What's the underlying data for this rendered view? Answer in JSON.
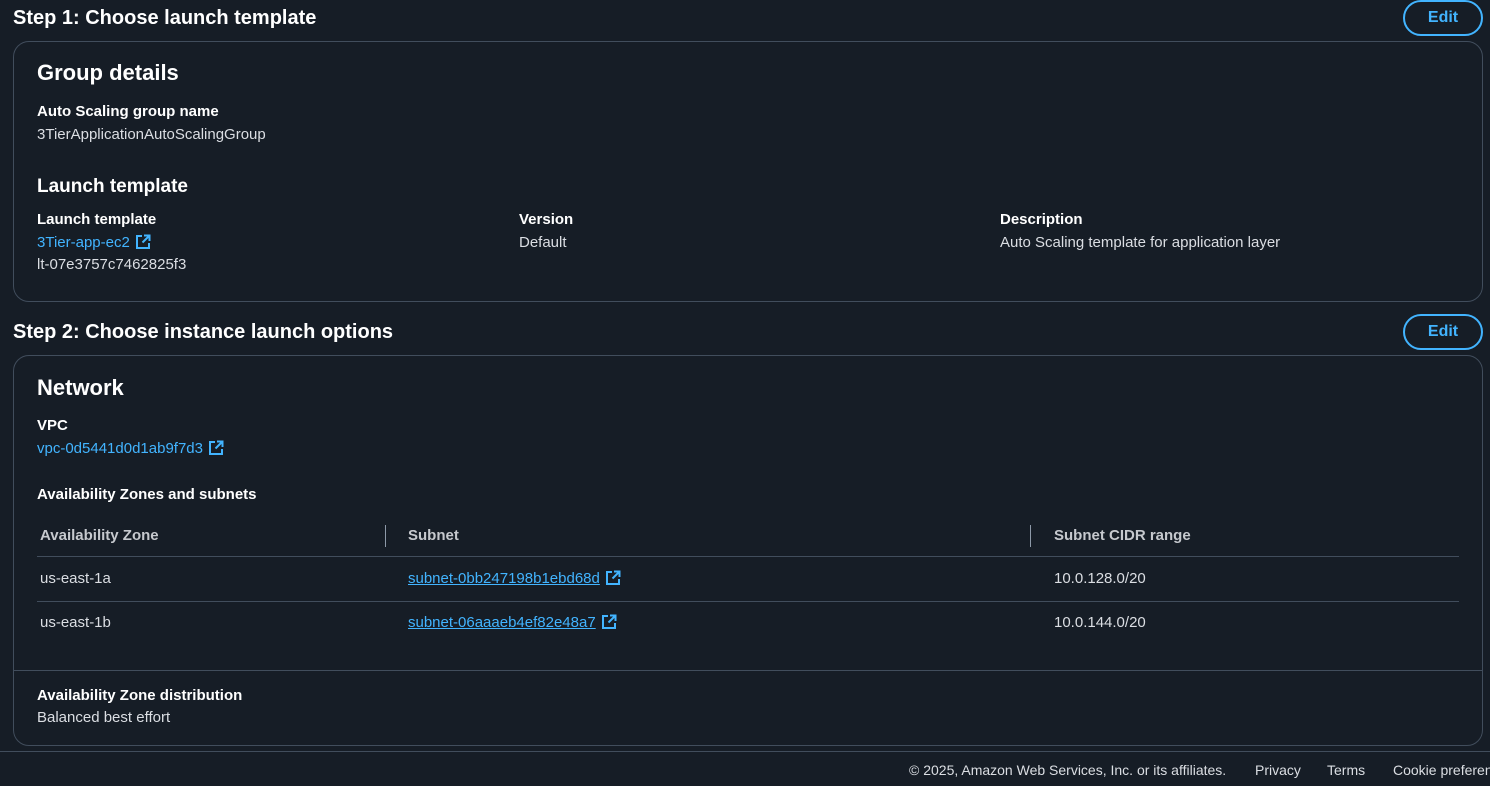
{
  "step1": {
    "title": "Step 1: Choose launch template",
    "edit_label": "Edit",
    "group_details": {
      "heading": "Group details",
      "name_label": "Auto Scaling group name",
      "name_value": "3TierApplicationAutoScalingGroup"
    },
    "launch_template": {
      "heading": "Launch template",
      "template_label": "Launch template",
      "template_link": "3Tier-app-ec2",
      "template_id": "lt-07e3757c7462825f3",
      "version_label": "Version",
      "version_value": "Default",
      "description_label": "Description",
      "description_value": "Auto Scaling template for application layer"
    }
  },
  "step2": {
    "title": "Step 2: Choose instance launch options",
    "edit_label": "Edit",
    "network": {
      "heading": "Network",
      "vpc_label": "VPC",
      "vpc_link": "vpc-0d5441d0d1ab9f7d3",
      "az_heading": "Availability Zones and subnets",
      "columns": [
        "Availability Zone",
        "Subnet",
        "Subnet CIDR range"
      ],
      "rows": [
        {
          "zone": "us-east-1a",
          "subnet": "subnet-0bb247198b1ebd68d",
          "cidr": "10.0.128.0/20"
        },
        {
          "zone": "us-east-1b",
          "subnet": "subnet-06aaaeb4ef82e48a7",
          "cidr": "10.0.144.0/20"
        }
      ],
      "distribution_label": "Availability Zone distribution",
      "distribution_value": "Balanced best effort"
    }
  },
  "footer": {
    "copyright": "© 2025, Amazon Web Services, Inc. or its affiliates.",
    "privacy": "Privacy",
    "terms": "Terms",
    "cookie": "Cookie preferences"
  },
  "icons": {
    "external_link": "external-link-icon"
  },
  "colors": {
    "background": "#161d26",
    "link": "#42b4ff",
    "border": "#414d5c",
    "heading": "#ffffff",
    "text": "#dbdee3"
  }
}
